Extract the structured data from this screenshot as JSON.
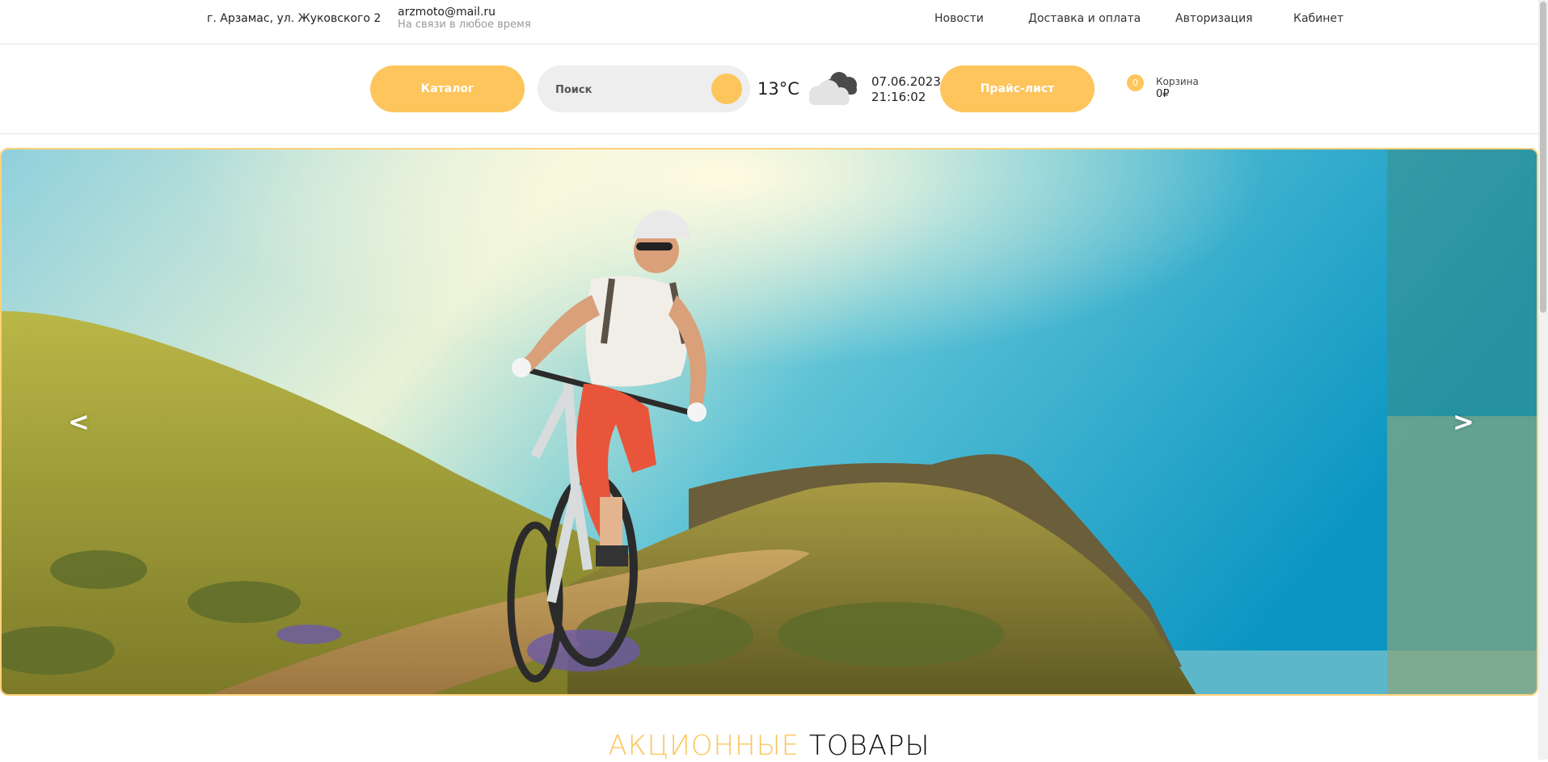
{
  "topbar": {
    "address": "г. Арзамас, ул. Жуковского 2",
    "email": "arzmoto@mail.ru",
    "availability": "На связи в любое время",
    "nav": [
      {
        "label": "Новости"
      },
      {
        "label": "Доставка и оплата"
      },
      {
        "label": "Авторизация"
      },
      {
        "label": "Кабинет"
      }
    ]
  },
  "toolbar": {
    "catalog_label": "Каталог",
    "search_placeholder": "Поиск",
    "temperature": "13°C",
    "weather_icon": "cloudy-icon",
    "date": "07.06.2023",
    "time": "21:16:02",
    "price_list_label": "Прайс-лист",
    "cart": {
      "count": "0",
      "label": "Корзина",
      "sum": "0₽"
    }
  },
  "slider": {
    "prev_label": "<",
    "next_label": ">"
  },
  "section": {
    "title_highlight": "АКЦИОННЫЕ",
    "title_rest": "ТОВАРЫ"
  },
  "colors": {
    "accent": "#fdc55c",
    "slider_border": "#ffd27a"
  }
}
